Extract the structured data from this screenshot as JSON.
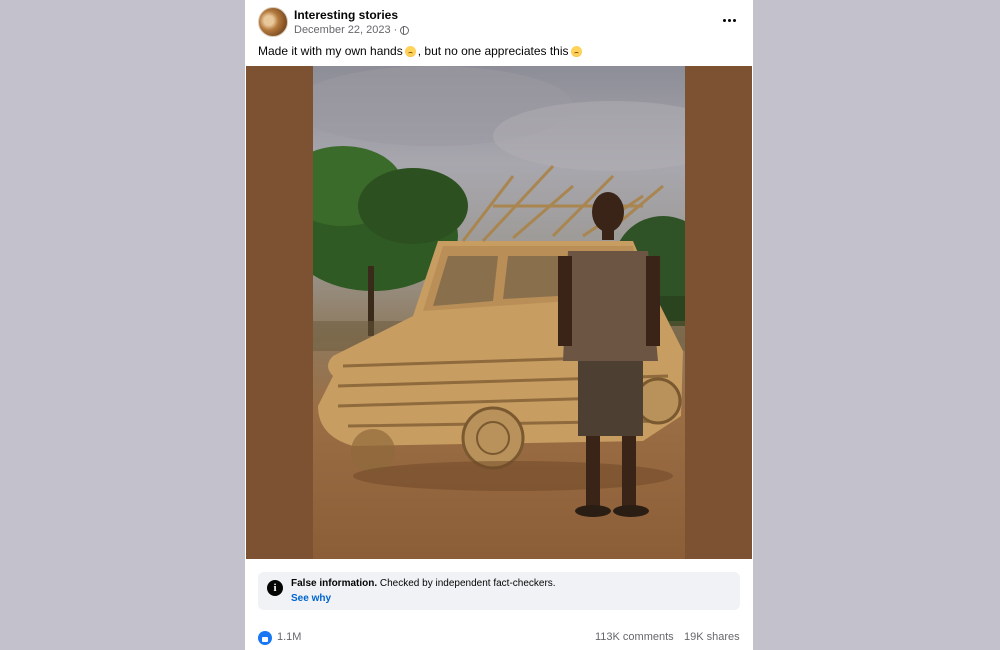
{
  "post": {
    "author": "Interesting stories",
    "date": "December 22, 2023 ·",
    "caption_part1": "Made it with my own hands",
    "caption_part2": ", but no one appreciates this"
  },
  "fact_check": {
    "label": "False information.",
    "text": " Checked by independent fact-checkers.",
    "link": "See why"
  },
  "stats": {
    "likes": "1.1M",
    "comments": "113K comments",
    "shares": "19K shares"
  },
  "icons": {
    "avatar": "avatar",
    "privacy": "globe-icon",
    "more": "more-options-icon",
    "info": "info-icon",
    "like": "like-icon",
    "caption_emoji": "emoji-icon"
  },
  "colors": {
    "page_bg": "#c2c1cc",
    "photo_side_bg": "#7d5233",
    "link": "#0064d1",
    "like_blue": "#1877f2"
  }
}
